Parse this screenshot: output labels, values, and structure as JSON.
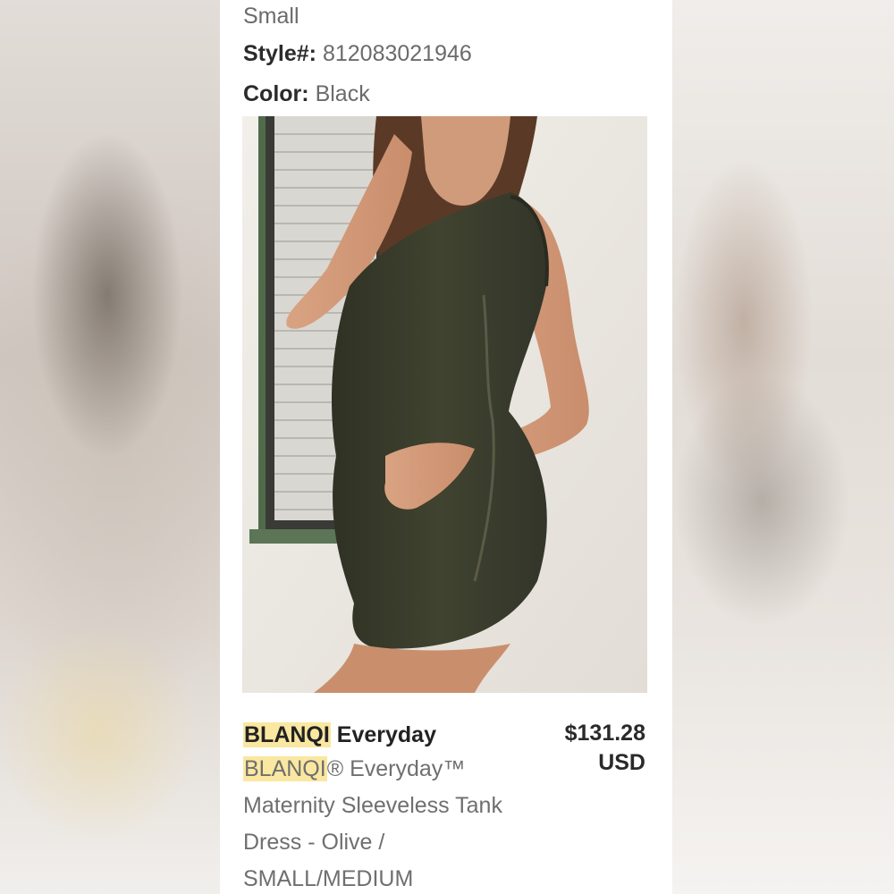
{
  "order": {
    "size_value": "Small",
    "style_label": "Style#",
    "style_value": "812083021946",
    "color_label": "Color:",
    "color_value": "Black"
  },
  "product": {
    "brand_highlight": "BLANQI",
    "title_rest": "Everyday",
    "desc_brand": "BLANQI",
    "desc_line1_rest": "® Everyday™",
    "desc_line2": "Maternity Sleeveless Tank",
    "desc_line3": "Dress - Olive /",
    "desc_line4": "SMALL/MEDIUM",
    "price_amount": "$131.28",
    "price_currency": "USD",
    "image_icon": "product-photo"
  },
  "colors": {
    "highlight": "#fae7a0",
    "dress": "#3b3d2c"
  }
}
